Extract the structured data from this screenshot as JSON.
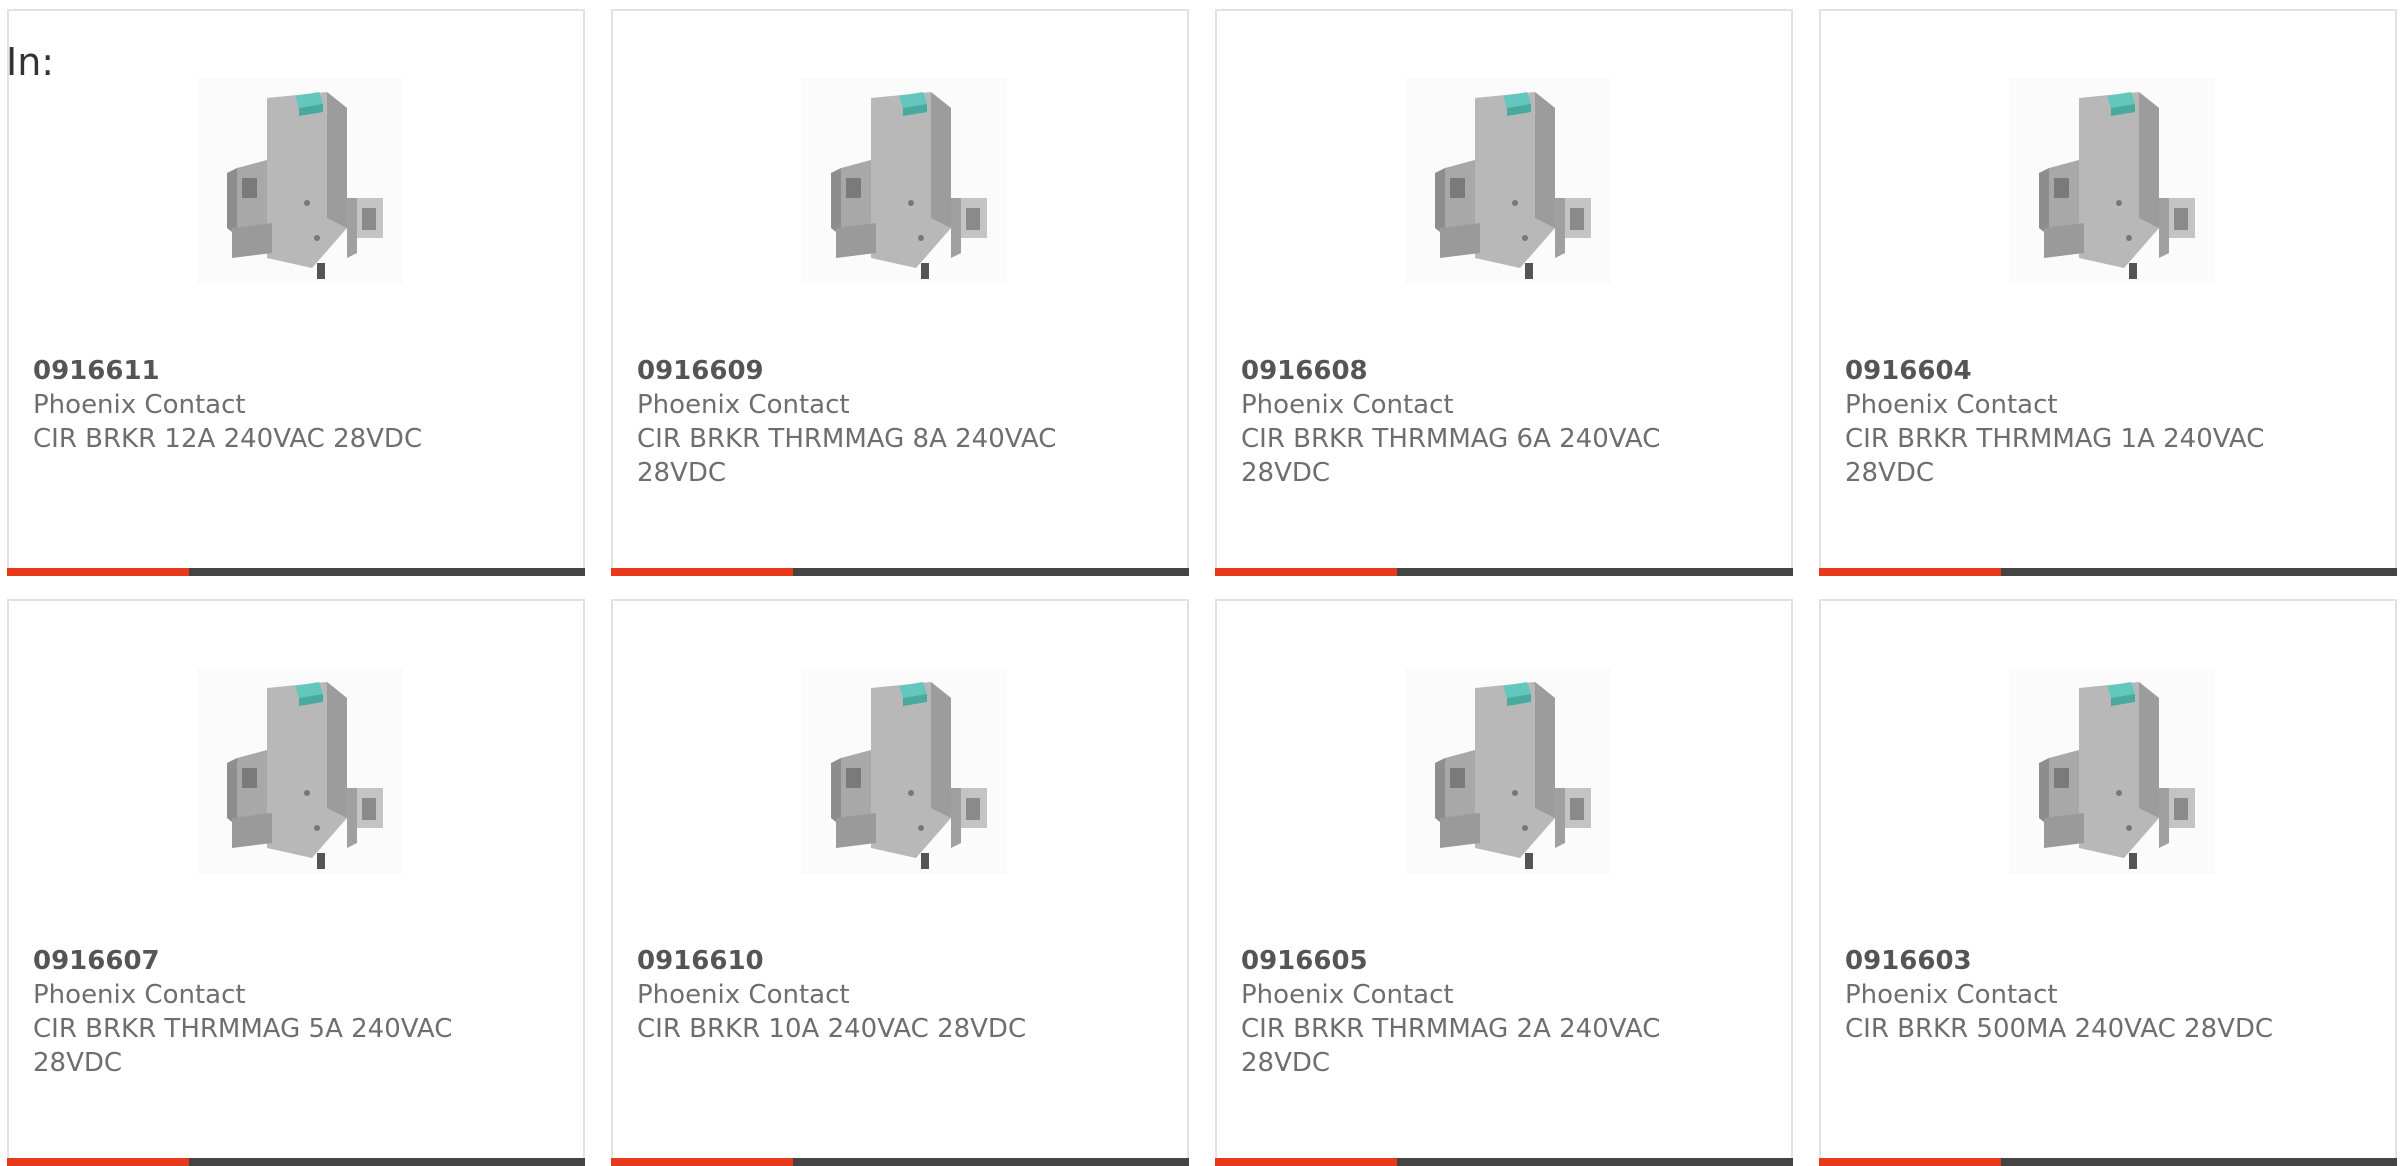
{
  "in_label": "In:",
  "accent_color": "#e8391d",
  "products": [
    {
      "part": "0916611",
      "manufacturer": "Phoenix Contact",
      "description": "CIR BRKR 12A 240VAC 28VDC"
    },
    {
      "part": "0916609",
      "manufacturer": "Phoenix Contact",
      "description": "CIR BRKR THRMMAG 8A 240VAC 28VDC"
    },
    {
      "part": "0916608",
      "manufacturer": "Phoenix Contact",
      "description": "CIR BRKR THRMMAG 6A 240VAC 28VDC"
    },
    {
      "part": "0916604",
      "manufacturer": "Phoenix Contact",
      "description": "CIR BRKR THRMMAG 1A 240VAC 28VDC"
    },
    {
      "part": "0916607",
      "manufacturer": "Phoenix Contact",
      "description": "CIR BRKR THRMMAG 5A 240VAC 28VDC"
    },
    {
      "part": "0916610",
      "manufacturer": "Phoenix Contact",
      "description": "CIR BRKR 10A 240VAC 28VDC"
    },
    {
      "part": "0916605",
      "manufacturer": "Phoenix Contact",
      "description": "CIR BRKR THRMMAG 2A 240VAC 28VDC"
    },
    {
      "part": "0916603",
      "manufacturer": "Phoenix Contact",
      "description": "CIR BRKR 500MA 240VAC 28VDC"
    }
  ]
}
